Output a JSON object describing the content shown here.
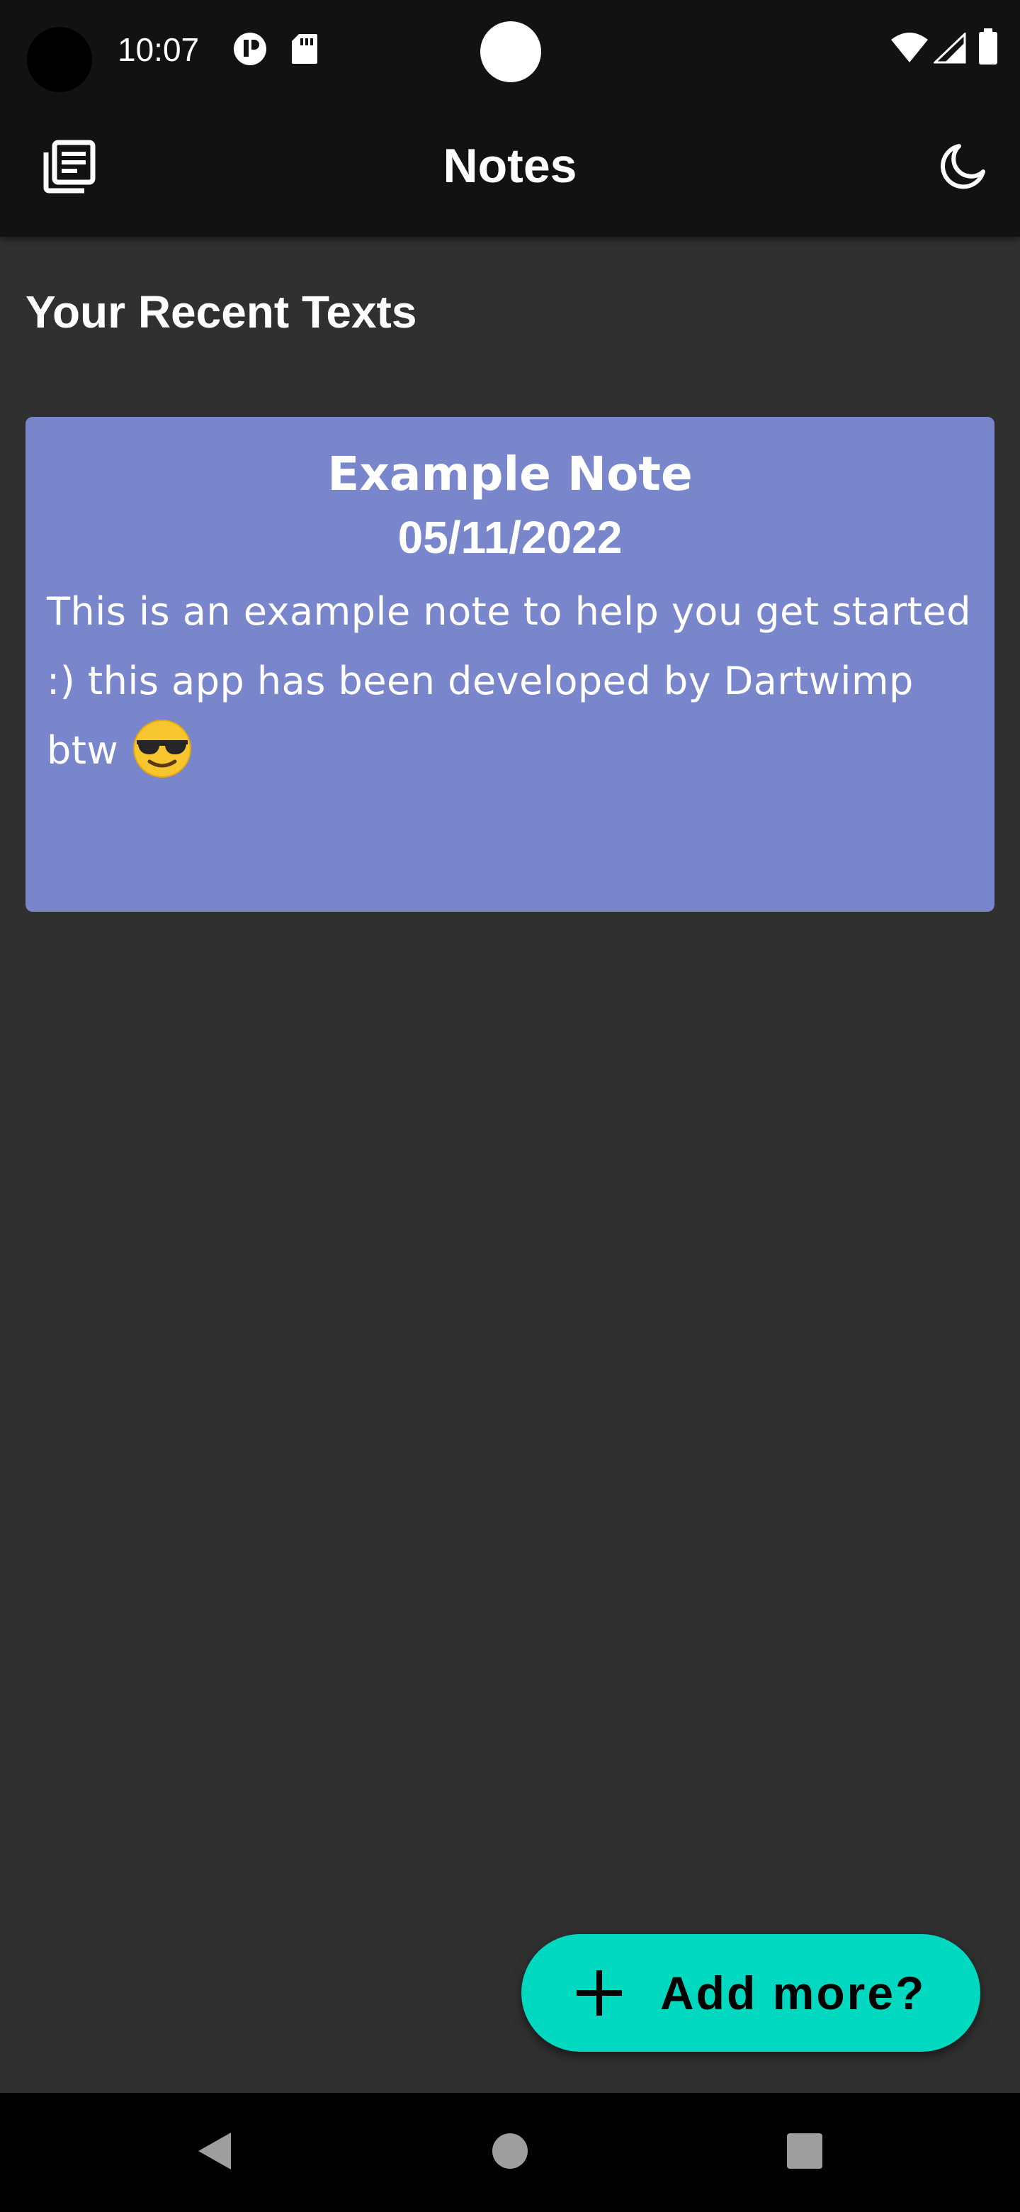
{
  "status_bar": {
    "time": "10:07",
    "icons": [
      "camera-cutout",
      "app-notification-icon",
      "sd-card-icon",
      "wifi-icon",
      "cell-signal-icon",
      "battery-icon"
    ]
  },
  "app_bar": {
    "title": "Notes",
    "left_icon": "notes-list-icon",
    "right_icon": "dark-mode-moon-icon"
  },
  "main": {
    "section_title": "Your Recent Texts",
    "notes": [
      {
        "title": "Example Note",
        "date": "05/11/2022",
        "body_line_1": "This is an example note to help you get started",
        "body_line_2": ":)  this app has been developed by Dartwimp",
        "body_line_3": "btw",
        "emoji": "sunglasses-face-emoji",
        "color": "#7986cb"
      }
    ]
  },
  "fab": {
    "icon": "plus-icon",
    "label": "Add more?",
    "color": "#00d8c0"
  },
  "nav_bar": {
    "icons": [
      "back-icon",
      "home-icon",
      "recents-icon"
    ]
  },
  "colors": {
    "background": "#303030",
    "bars": "#121212",
    "text": "#ffffff"
  }
}
